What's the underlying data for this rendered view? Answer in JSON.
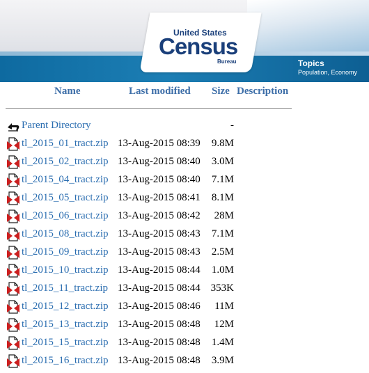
{
  "banner": {
    "logo_top": "United States",
    "logo_main": "Census",
    "logo_bottom": "Bureau",
    "topics_title": "Topics",
    "topics_sub": "Population, Economy"
  },
  "columns": {
    "name": "Name",
    "modified": "Last modified",
    "size": "Size",
    "description": "Description"
  },
  "parent": {
    "label": "Parent Directory",
    "size": "-",
    "icon": "back-arrow-icon"
  },
  "files": [
    {
      "name": "tl_2015_01_tract.zip",
      "date": "13-Aug-2015 08:39",
      "size": "9.8M"
    },
    {
      "name": "tl_2015_02_tract.zip",
      "date": "13-Aug-2015 08:40",
      "size": "3.0M"
    },
    {
      "name": "tl_2015_04_tract.zip",
      "date": "13-Aug-2015 08:40",
      "size": "7.1M"
    },
    {
      "name": "tl_2015_05_tract.zip",
      "date": "13-Aug-2015 08:41",
      "size": "8.1M"
    },
    {
      "name": "tl_2015_06_tract.zip",
      "date": "13-Aug-2015 08:42",
      "size": "28M"
    },
    {
      "name": "tl_2015_08_tract.zip",
      "date": "13-Aug-2015 08:43",
      "size": "7.1M"
    },
    {
      "name": "tl_2015_09_tract.zip",
      "date": "13-Aug-2015 08:43",
      "size": "2.5M"
    },
    {
      "name": "tl_2015_10_tract.zip",
      "date": "13-Aug-2015 08:44",
      "size": "1.0M"
    },
    {
      "name": "tl_2015_11_tract.zip",
      "date": "13-Aug-2015 08:44",
      "size": "353K"
    },
    {
      "name": "tl_2015_12_tract.zip",
      "date": "13-Aug-2015 08:46",
      "size": "11M"
    },
    {
      "name": "tl_2015_13_tract.zip",
      "date": "13-Aug-2015 08:48",
      "size": "12M"
    },
    {
      "name": "tl_2015_15_tract.zip",
      "date": "13-Aug-2015 08:48",
      "size": "1.4M"
    },
    {
      "name": "tl_2015_16_tract.zip",
      "date": "13-Aug-2015 08:48",
      "size": "3.9M"
    }
  ],
  "colors": {
    "link": "#2a6db0",
    "brand": "#1a3f7a",
    "bar": "#0e6aa0",
    "zip_icon_red": "#cc1f1f"
  }
}
